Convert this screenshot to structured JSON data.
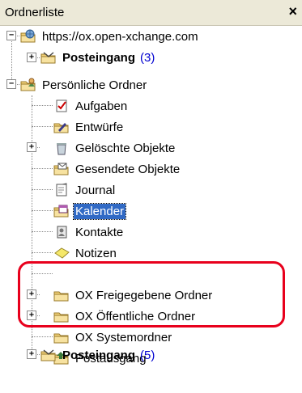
{
  "panel": {
    "title": "Ordnerliste",
    "close_glyph": "×"
  },
  "tree": {
    "server": {
      "label": "https://ox.open-xchange.com",
      "expander": "−",
      "icon": "globe-folder-icon"
    },
    "server_inbox": {
      "label": "Posteingang",
      "count": "(3)",
      "expander": "+",
      "icon": "inbox-folder-icon"
    },
    "personal": {
      "label": "Persönliche Ordner",
      "expander": "−",
      "icon": "personal-folders-icon"
    },
    "items": {
      "aufgaben": {
        "label": "Aufgaben",
        "icon": "tasks-icon"
      },
      "entwuerfe": {
        "label": "Entwürfe",
        "icon": "drafts-folder-icon"
      },
      "geloescht": {
        "label": "Gelöschte Objekte",
        "expander": "+",
        "icon": "trash-icon"
      },
      "gesendet": {
        "label": "Gesendete Objekte",
        "icon": "sent-folder-icon"
      },
      "journal": {
        "label": "Journal",
        "icon": "journal-icon"
      },
      "kalender": {
        "label": "Kalender",
        "icon": "calendar-icon"
      },
      "kontakte": {
        "label": "Kontakte",
        "icon": "contacts-icon"
      },
      "notizen": {
        "label": "Notizen",
        "icon": "notes-icon"
      },
      "ox_freigegeben": {
        "label": "OX Freigegebene Ordner",
        "icon": "folder-icon"
      },
      "ox_oeffentlich": {
        "label": "OX Öffentliche Ordner",
        "expander": "+",
        "icon": "folder-icon"
      },
      "ox_system": {
        "label": "OX Systemordner",
        "expander": "+",
        "icon": "folder-icon"
      },
      "postausgang": {
        "label": "Postausgang",
        "icon": "outbox-icon"
      },
      "posteingang": {
        "label": "Posteingang",
        "count": "(5)",
        "expander": "+",
        "icon": "inbox-folder-icon"
      }
    }
  },
  "colors": {
    "selection": "#316ac5",
    "highlight_border": "#e8001c",
    "count": "#0000d0"
  }
}
